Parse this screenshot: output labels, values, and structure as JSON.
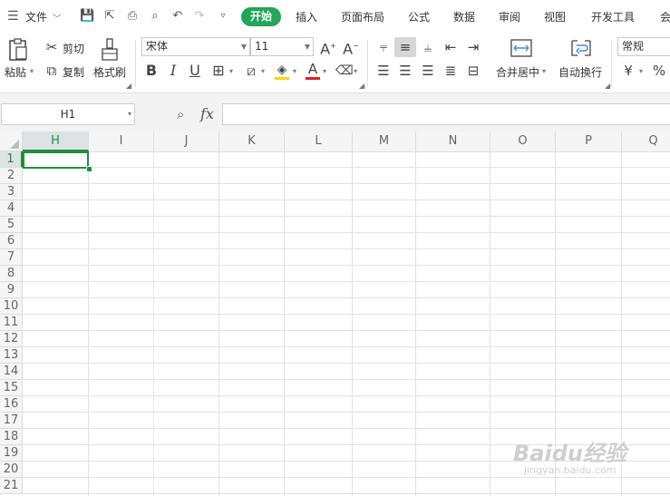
{
  "menu": {
    "file_label": "文件",
    "tabs": [
      "开始",
      "插入",
      "页面布局",
      "公式",
      "数据",
      "审阅",
      "视图",
      "开发工具",
      "会"
    ],
    "active_tab": "开始"
  },
  "ribbon": {
    "paste_label": "粘贴",
    "cut_label": "剪切",
    "copy_label": "复制",
    "format_painter_label": "格式刷",
    "font_name": "宋体",
    "font_size": "11",
    "merge_center_label": "合并居中",
    "wrap_text_label": "自动换行",
    "number_format": "常规",
    "currency_symbol": "¥",
    "percent_symbol": "%",
    "font_color": "#e02020",
    "fill_color": "#ffd400"
  },
  "formula_bar": {
    "name_box": "H1",
    "fx_label": "fx",
    "formula": ""
  },
  "grid": {
    "columns": [
      "H",
      "I",
      "J",
      "K",
      "L",
      "M",
      "N",
      "O",
      "P",
      "Q"
    ],
    "rows": [
      "1",
      "2",
      "3",
      "4",
      "5",
      "6",
      "7",
      "8",
      "9",
      "10",
      "11",
      "12",
      "13",
      "14",
      "15",
      "16",
      "17",
      "18",
      "19",
      "20",
      "21"
    ],
    "selected_cell": "H1",
    "selection_color": "#1f8f3a"
  },
  "watermark": {
    "brand": "Baidu经验",
    "url": "jingyan.baidu.com"
  }
}
